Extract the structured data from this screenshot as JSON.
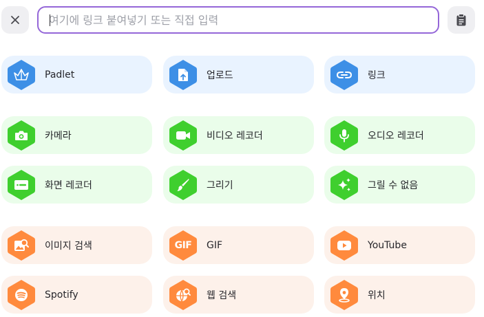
{
  "toolbar": {
    "close_icon": "close-icon",
    "clipboard_icon": "clipboard-icon",
    "search": {
      "placeholder": "여기에 링크 붙여넣기 또는 직접 입력",
      "value": ""
    }
  },
  "colors": {
    "accent_border": "#9466d8",
    "blue_hex": "#3d8fe6",
    "blue_tile": "#e9f3ff",
    "green_hex": "#3fcf2e",
    "green_tile": "#eafdea",
    "orange_hex": "#ff8a3d",
    "orange_tile": "#fdf1ea"
  },
  "options": {
    "padlet": {
      "label": "Padlet",
      "icon": "padlet-logo-icon"
    },
    "upload": {
      "label": "업로드",
      "icon": "upload-file-icon"
    },
    "link": {
      "label": "링크",
      "icon": "link-icon"
    },
    "camera": {
      "label": "카메라",
      "icon": "camera-icon"
    },
    "video_recorder": {
      "label": "비디오 레코더",
      "icon": "video-camera-icon"
    },
    "audio_recorder": {
      "label": "오디오 레코더",
      "icon": "microphone-icon"
    },
    "screen_recorder": {
      "label": "화면 레코더",
      "icon": "screen-record-icon"
    },
    "draw": {
      "label": "그리기",
      "icon": "brush-icon"
    },
    "ai_image": {
      "label": "그릴 수 없음",
      "icon": "sparkles-icon"
    },
    "image_search": {
      "label": "이미지 검색",
      "icon": "image-search-icon"
    },
    "gif": {
      "label": "GIF",
      "icon": "gif-icon",
      "badge": "GIF"
    },
    "youtube": {
      "label": "YouTube",
      "icon": "youtube-icon"
    },
    "spotify": {
      "label": "Spotify",
      "icon": "spotify-icon"
    },
    "web_search": {
      "label": "웹 검색",
      "icon": "web-search-icon"
    },
    "location": {
      "label": "위치",
      "icon": "location-pin-icon"
    }
  }
}
